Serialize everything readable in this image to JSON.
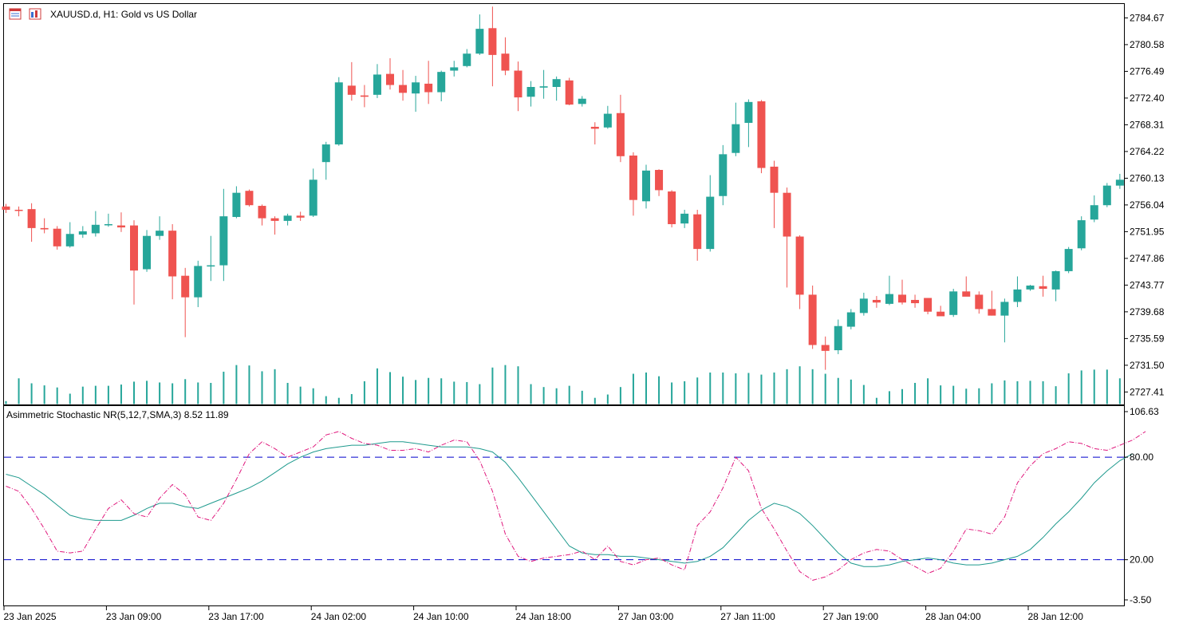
{
  "header": {
    "symbol_title": "XAUUSD.d, H1:  Gold vs US Dollar"
  },
  "indicator": {
    "label": "Asimmetric Stochastic NR(5,12,7,SMA,3) 8.52 11.89"
  },
  "colors": {
    "bull": "#26a69a",
    "bear": "#ef5350",
    "volume": "#26a69a",
    "main_line": "#1f9a8e",
    "signal_line": "#e0197d",
    "level_line": "#0000cc",
    "frame": "#000000"
  },
  "icons": [
    "chart-menu-icon",
    "indicator-list-icon"
  ],
  "chart_data": [
    {
      "type": "candlestick",
      "symbol": "XAUUSD.d",
      "timeframe": "H1",
      "ylim": [
        2725.5,
        2786.8
      ],
      "price_ticks": [
        "2784.67",
        "2780.58",
        "2776.49",
        "2772.40",
        "2768.31",
        "2764.22",
        "2760.13",
        "2756.04",
        "2751.95",
        "2747.86",
        "2743.77",
        "2739.68",
        "2735.59",
        "2731.50",
        "2727.41"
      ],
      "time_labels": [
        "23 Jan 2025",
        "23 Jan 09:00",
        "23 Jan 17:00",
        "24 Jan 02:00",
        "24 Jan 10:00",
        "24 Jan 18:00",
        "27 Jan 03:00",
        "27 Jan 11:00",
        "27 Jan 19:00",
        "28 Jan 04:00",
        "28 Jan 12:00"
      ],
      "time_label_bar_index": [
        0,
        8,
        16,
        24,
        32,
        40,
        48,
        56,
        64,
        72,
        80
      ],
      "ohlc": [
        [
          2755.8,
          2756.2,
          2754.8,
          2755.3
        ],
        [
          2755.3,
          2755.8,
          2754.3,
          2755.2
        ],
        [
          2755.4,
          2756.3,
          2750.4,
          2752.5
        ],
        [
          2752.5,
          2754.0,
          2751.7,
          2752.3
        ],
        [
          2752.4,
          2752.8,
          2749.2,
          2749.7
        ],
        [
          2749.7,
          2753.4,
          2749.5,
          2751.6
        ],
        [
          2751.5,
          2752.8,
          2751.0,
          2752.0
        ],
        [
          2751.7,
          2755.1,
          2751.2,
          2753.0
        ],
        [
          2753.1,
          2754.7,
          2752.7,
          2753.1
        ],
        [
          2752.9,
          2754.9,
          2751.9,
          2752.6
        ],
        [
          2752.9,
          2753.7,
          2740.8,
          2746.0
        ],
        [
          2746.2,
          2752.2,
          2745.8,
          2751.3
        ],
        [
          2751.3,
          2754.3,
          2750.7,
          2752.1
        ],
        [
          2752.1,
          2753.1,
          2741.6,
          2745.1
        ],
        [
          2745.2,
          2746.4,
          2735.8,
          2741.9
        ],
        [
          2741.9,
          2747.5,
          2740.4,
          2746.7
        ],
        [
          2746.7,
          2751.3,
          2744.4,
          2746.8
        ],
        [
          2746.8,
          2758.5,
          2744.4,
          2754.3
        ],
        [
          2754.2,
          2758.9,
          2754.0,
          2757.9
        ],
        [
          2758.2,
          2758.4,
          2755.8,
          2756.0
        ],
        [
          2755.9,
          2756.1,
          2752.9,
          2754.0
        ],
        [
          2754.0,
          2754.3,
          2751.5,
          2753.6
        ],
        [
          2753.6,
          2754.7,
          2752.9,
          2754.4
        ],
        [
          2754.4,
          2755.0,
          2753.6,
          2754.1
        ],
        [
          2754.4,
          2761.6,
          2754.2,
          2759.9
        ],
        [
          2762.6,
          2765.7,
          2759.9,
          2765.3
        ],
        [
          2765.3,
          2775.6,
          2765.1,
          2774.8
        ],
        [
          2774.3,
          2777.9,
          2772.0,
          2772.9
        ],
        [
          2772.8,
          2774.4,
          2771.0,
          2772.6
        ],
        [
          2772.9,
          2777.6,
          2772.4,
          2776.0
        ],
        [
          2776.1,
          2778.5,
          2773.7,
          2774.4
        ],
        [
          2774.4,
          2776.7,
          2772.0,
          2773.2
        ],
        [
          2773.1,
          2775.8,
          2770.3,
          2774.8
        ],
        [
          2774.6,
          2778.1,
          2771.5,
          2773.3
        ],
        [
          2773.3,
          2776.6,
          2771.9,
          2776.4
        ],
        [
          2776.6,
          2778.1,
          2775.7,
          2777.1
        ],
        [
          2777.3,
          2779.9,
          2777.1,
          2779.2
        ],
        [
          2779.2,
          2785.2,
          2779.0,
          2783.0
        ],
        [
          2783.1,
          2786.4,
          2774.2,
          2779.0
        ],
        [
          2779.2,
          2781.7,
          2775.9,
          2776.6
        ],
        [
          2776.6,
          2778.0,
          2770.4,
          2772.5
        ],
        [
          2772.6,
          2775.0,
          2771.1,
          2774.1
        ],
        [
          2774.0,
          2776.7,
          2772.3,
          2774.2
        ],
        [
          2774.1,
          2775.7,
          2772.0,
          2775.3
        ],
        [
          2775.1,
          2775.5,
          2771.3,
          2771.4
        ],
        [
          2771.5,
          2772.7,
          2771.1,
          2772.3
        ],
        [
          2768.0,
          2768.7,
          2765.3,
          2767.7
        ],
        [
          2767.9,
          2771.2,
          2767.7,
          2770.0
        ],
        [
          2770.1,
          2772.9,
          2762.6,
          2763.5
        ],
        [
          2763.6,
          2764.1,
          2754.4,
          2756.8
        ],
        [
          2756.6,
          2762.2,
          2755.5,
          2761.3
        ],
        [
          2761.4,
          2761.5,
          2757.4,
          2758.3
        ],
        [
          2758.1,
          2758.3,
          2752.6,
          2753.1
        ],
        [
          2753.2,
          2755.3,
          2752.5,
          2754.7
        ],
        [
          2754.6,
          2755.3,
          2747.5,
          2749.3
        ],
        [
          2749.3,
          2760.6,
          2748.9,
          2757.3
        ],
        [
          2757.4,
          2765.2,
          2756.0,
          2763.8
        ],
        [
          2764.0,
          2771.7,
          2763.5,
          2768.4
        ],
        [
          2768.6,
          2772.2,
          2764.9,
          2771.8
        ],
        [
          2771.9,
          2772.1,
          2760.9,
          2761.7
        ],
        [
          2761.9,
          2762.8,
          2752.5,
          2757.9
        ],
        [
          2757.9,
          2758.7,
          2743.4,
          2751.2
        ],
        [
          2751.2,
          2751.4,
          2740.1,
          2742.3
        ],
        [
          2742.3,
          2743.7,
          2734.0,
          2734.6
        ],
        [
          2734.6,
          2735.9,
          2730.8,
          2733.7
        ],
        [
          2733.8,
          2738.5,
          2733.2,
          2737.5
        ],
        [
          2737.4,
          2740.1,
          2737.0,
          2739.6
        ],
        [
          2739.5,
          2742.6,
          2739.1,
          2741.7
        ],
        [
          2741.5,
          2742.1,
          2740.3,
          2741.1
        ],
        [
          2740.9,
          2745.2,
          2740.7,
          2742.4
        ],
        [
          2742.3,
          2744.6,
          2740.8,
          2741.1
        ],
        [
          2741.5,
          2742.3,
          2740.3,
          2741.0
        ],
        [
          2741.8,
          2741.8,
          2739.3,
          2739.7
        ],
        [
          2739.7,
          2740.6,
          2739.2,
          2739.0
        ],
        [
          2739.2,
          2743.2,
          2738.9,
          2742.8
        ],
        [
          2742.8,
          2745.1,
          2742.1,
          2742.0
        ],
        [
          2742.3,
          2742.8,
          2739.4,
          2740.1
        ],
        [
          2740.1,
          2742.9,
          2739.1,
          2739.1
        ],
        [
          2739.1,
          2741.7,
          2735.0,
          2741.2
        ],
        [
          2741.2,
          2745.1,
          2740.4,
          2743.1
        ],
        [
          2743.1,
          2743.8,
          2742.9,
          2743.7
        ],
        [
          2743.6,
          2745.2,
          2742.0,
          2743.2
        ],
        [
          2743.1,
          2746.0,
          2741.3,
          2745.9
        ],
        [
          2745.9,
          2749.6,
          2745.6,
          2749.3
        ],
        [
          2749.4,
          2754.3,
          2749.1,
          2753.7
        ],
        [
          2753.8,
          2757.5,
          2753.4,
          2756.0
        ],
        [
          2756.0,
          2759.4,
          2755.7,
          2759.0
        ],
        [
          2759.0,
          2760.8,
          2758.5,
          2759.9
        ]
      ],
      "volume_relative": [
        0.07,
        0.62,
        0.5,
        0.45,
        0.4,
        0.25,
        0.42,
        0.44,
        0.44,
        0.47,
        0.54,
        0.56,
        0.52,
        0.5,
        0.6,
        0.52,
        0.51,
        0.78,
        0.94,
        0.93,
        0.79,
        0.84,
        0.51,
        0.42,
        0.38,
        0.19,
        0.15,
        0.24,
        0.55,
        0.86,
        0.77,
        0.66,
        0.58,
        0.63,
        0.62,
        0.54,
        0.53,
        0.48,
        0.88,
        0.94,
        0.91,
        0.48,
        0.41,
        0.38,
        0.44,
        0.32,
        0.15,
        0.23,
        0.41,
        0.73,
        0.76,
        0.67,
        0.52,
        0.55,
        0.64,
        0.76,
        0.76,
        0.74,
        0.75,
        0.71,
        0.76,
        0.84,
        0.91,
        0.84,
        0.73,
        0.63,
        0.59,
        0.46,
        0.15,
        0.31,
        0.36,
        0.51,
        0.62,
        0.45,
        0.44,
        0.37,
        0.38,
        0.5,
        0.57,
        0.55,
        0.56,
        0.55,
        0.43,
        0.74,
        0.81,
        0.83,
        0.83,
        0.62
      ]
    },
    {
      "type": "line",
      "title": "Asimmetric Stochastic NR(5,12,7,SMA,3) 8.52 11.89",
      "ylim": [
        -3.5,
        106.63
      ],
      "y_ticks": [
        "106.63",
        "80.00",
        "20.00",
        "-3.50"
      ],
      "levels": [
        80,
        20
      ],
      "series": [
        {
          "color": "#1f9a8e",
          "style": "solid",
          "values": [
            70,
            68,
            63,
            58,
            52,
            46,
            44,
            43,
            43,
            43,
            46,
            50,
            53,
            53,
            51,
            50,
            53,
            56,
            59,
            62,
            66,
            71,
            76,
            80,
            83,
            85,
            86,
            87,
            87,
            88,
            89,
            89,
            88,
            87,
            86,
            86,
            86,
            85,
            83,
            77,
            68,
            58,
            48,
            38,
            28,
            24,
            23,
            23,
            22,
            22,
            21,
            20,
            19,
            18,
            19,
            22,
            27,
            35,
            43,
            49,
            53,
            51,
            47,
            40,
            32,
            24,
            18,
            16,
            16,
            17,
            19,
            20,
            21,
            20,
            18,
            17,
            17,
            18,
            20,
            22,
            26,
            33,
            41,
            48,
            56,
            65,
            72,
            78,
            82
          ]
        },
        {
          "color": "#e0197d",
          "style": "dash-dot",
          "values": [
            63,
            60,
            50,
            38,
            25,
            24,
            25,
            38,
            50,
            55,
            47,
            45,
            56,
            64,
            58,
            45,
            43,
            53,
            67,
            82,
            89,
            85,
            80,
            83,
            86,
            93,
            95,
            91,
            88,
            87,
            84,
            84,
            85,
            83,
            87,
            90,
            89,
            78,
            60,
            35,
            22,
            19,
            21,
            22,
            23,
            25,
            20,
            28,
            19,
            17,
            20,
            21,
            17,
            14,
            40,
            48,
            62,
            80,
            72,
            50,
            38,
            25,
            13,
            8,
            10,
            14,
            20,
            24,
            26,
            25,
            20,
            16,
            12,
            15,
            25,
            38,
            37,
            35,
            45,
            65,
            75,
            82,
            85,
            89,
            88,
            85,
            84,
            87,
            90,
            95
          ]
        }
      ]
    }
  ]
}
